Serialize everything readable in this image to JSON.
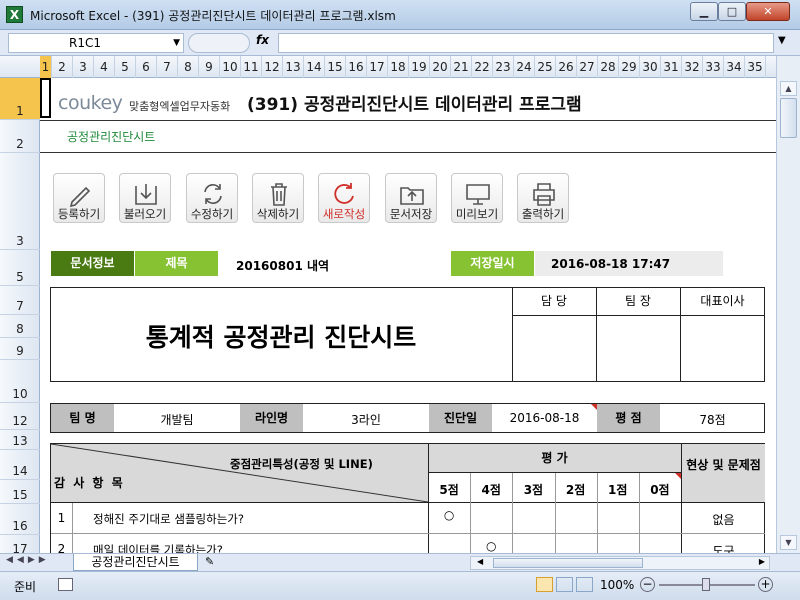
{
  "window": {
    "title": "Microsoft Excel - (391) 공정관리진단시트 데이터관리 프로그램.xlsm",
    "app_icon": "X"
  },
  "formula_bar": {
    "name_box": "R1C1",
    "fx": "fx",
    "formula": ""
  },
  "columns": [
    "1",
    "2",
    "3",
    "4",
    "5",
    "6",
    "7",
    "8",
    "9",
    "10",
    "11",
    "12",
    "13",
    "14",
    "15",
    "16",
    "17",
    "18",
    "19",
    "20",
    "21",
    "22",
    "23",
    "24",
    "25",
    "26",
    "27",
    "28",
    "29",
    "30",
    "31",
    "32",
    "33",
    "34",
    "35"
  ],
  "rows": [
    "1",
    "2",
    "3",
    "5",
    "7",
    "8",
    "9",
    "10",
    "12",
    "13",
    "14",
    "15",
    "16",
    "17"
  ],
  "header": {
    "brand": "coukey",
    "brand_sub": "맞춤형엑셀업무자동화",
    "title": "(391) 공정관리진단시트 데이터관리 프로그램",
    "subtitle": "공정관리진단시트"
  },
  "toolbar": [
    {
      "label": "등록하기",
      "icon": "pencil-icon"
    },
    {
      "label": "불러오기",
      "icon": "load-icon"
    },
    {
      "label": "수정하기",
      "icon": "refresh-icon"
    },
    {
      "label": "삭제하기",
      "icon": "trash-icon"
    },
    {
      "label": "새로작성",
      "icon": "new-icon"
    },
    {
      "label": "문서저장",
      "icon": "folder-save-icon"
    },
    {
      "label": "미리보기",
      "icon": "preview-icon"
    },
    {
      "label": "출력하기",
      "icon": "printer-icon"
    }
  ],
  "docinfo": {
    "label": "문서정보",
    "title_label": "제목",
    "title_value": "20160801 내역",
    "saved_label": "저장일시",
    "saved_value": "2016-08-18 17:47"
  },
  "form": {
    "heading": "통계적 공정관리 진단시트",
    "approvals": [
      "담 당",
      "팀 장",
      "대표이사"
    ],
    "team_label": "팀 명",
    "team_value": "개발팀",
    "line_label": "라인명",
    "line_value": "3라인",
    "date_label": "진단일",
    "date_value": "2016-08-18",
    "score_label": "평 점",
    "score_value": "78점"
  },
  "table": {
    "col_head": "중점관리특성(공정 및 LINE)",
    "row_head": "감 사 항 목",
    "eval_head": "평 가",
    "scores": [
      "5점",
      "4점",
      "3점",
      "2점",
      "1점",
      "0점"
    ],
    "status_head": "현상 및 문제점",
    "rows": [
      {
        "no": "1",
        "item": "정해진 주기대로 샘플링하는가?",
        "mark_col": 0,
        "mark": "○",
        "status": "없음"
      },
      {
        "no": "2",
        "item": "매일 데이터를 기록하는가?",
        "mark_col": 1,
        "mark": "○",
        "status": "도구"
      }
    ]
  },
  "sheet_tabs": {
    "active": "공정관리진단시트"
  },
  "status": {
    "ready": "준비",
    "zoom": "100%"
  },
  "colors": {
    "dark_green": "#4a7a12",
    "light_green": "#86c232",
    "gray": "#bfbfbf"
  }
}
